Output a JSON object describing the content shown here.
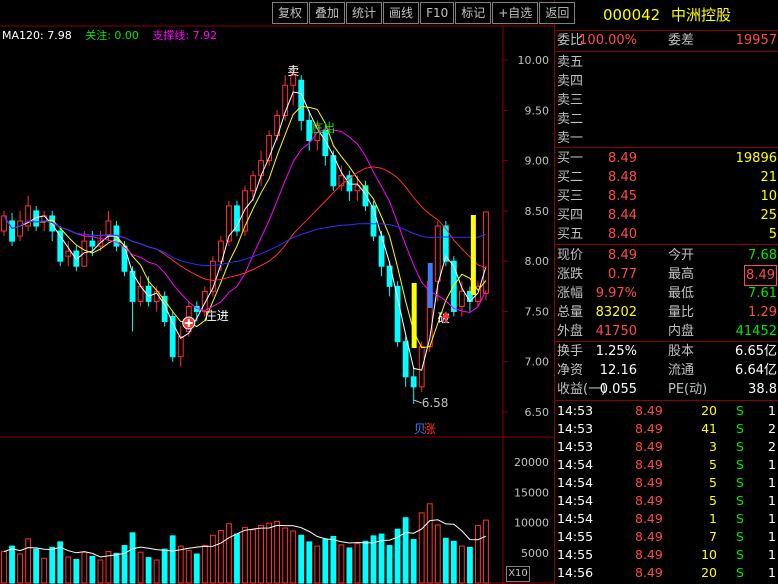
{
  "toolbar": {
    "buttons": [
      "复权",
      "叠加",
      "统计",
      "画线",
      "F10",
      "标记",
      "+自选",
      "返回"
    ]
  },
  "indicator_line": {
    "ma120": "MA120: 7.98",
    "focus": "关注: 0.00",
    "support": "支撑线: 7.92"
  },
  "annotations": {
    "sell": "卖",
    "zhuang_out": "庄出",
    "zhuang_in": "庄进",
    "break_down": "破",
    "low_price": "6.58",
    "limit_up": "涨",
    "limit_up_prefix": "贝"
  },
  "price_axis": [
    "10.00",
    "9.50",
    "9.00",
    "8.50",
    "8.00",
    "7.50",
    "7.00",
    "6.50"
  ],
  "volume_axis": [
    "20000",
    "15000",
    "10000",
    "5000"
  ],
  "volume_unit_button": "X10",
  "colors": {
    "up": "#ff3030",
    "down": "#00ffff",
    "ma_white": "#ffffff",
    "ma_yellow": "#ffff00",
    "ma_pink": "#ff00ff",
    "ma_red": "#ff3030",
    "ma_blue": "#3030ff"
  },
  "chart_data": {
    "type": "candlestick",
    "ylim": [
      6.5,
      10.2
    ],
    "candles": [
      [
        8.3,
        8.45,
        8.25,
        8.5
      ],
      [
        8.4,
        8.2,
        8.15,
        8.48
      ],
      [
        8.25,
        8.4,
        8.2,
        8.5
      ],
      [
        8.35,
        8.55,
        8.3,
        8.65
      ],
      [
        8.5,
        8.35,
        8.3,
        8.55
      ],
      [
        8.4,
        8.45,
        8.3,
        8.5
      ],
      [
        8.45,
        8.3,
        8.2,
        8.5
      ],
      [
        8.3,
        8.0,
        7.95,
        8.35
      ],
      [
        8.05,
        8.1,
        7.95,
        8.2
      ],
      [
        8.1,
        7.95,
        7.9,
        8.15
      ],
      [
        7.95,
        8.2,
        7.95,
        8.3
      ],
      [
        8.2,
        8.15,
        8.05,
        8.3
      ],
      [
        8.15,
        8.2,
        8.1,
        8.3
      ],
      [
        8.25,
        8.4,
        8.2,
        8.5
      ],
      [
        8.35,
        8.15,
        8.1,
        8.4
      ],
      [
        8.15,
        7.9,
        7.85,
        8.2
      ],
      [
        7.9,
        7.6,
        7.3,
        7.95
      ],
      [
        7.6,
        7.75,
        7.55,
        7.85
      ],
      [
        7.75,
        7.6,
        7.55,
        7.85
      ],
      [
        7.6,
        7.7,
        7.5,
        7.75
      ],
      [
        7.65,
        7.4,
        7.35,
        7.7
      ],
      [
        7.45,
        7.05,
        7.0,
        7.5
      ],
      [
        7.05,
        7.25,
        6.95,
        7.35
      ],
      [
        7.3,
        7.55,
        7.25,
        7.6
      ],
      [
        7.55,
        7.5,
        7.4,
        7.6
      ],
      [
        7.5,
        7.7,
        7.45,
        7.75
      ],
      [
        7.7,
        8.0,
        7.65,
        8.05
      ],
      [
        8.0,
        8.2,
        7.9,
        8.25
      ],
      [
        8.2,
        8.55,
        8.15,
        8.6
      ],
      [
        8.55,
        8.3,
        8.25,
        8.6
      ],
      [
        8.3,
        8.7,
        8.25,
        8.75
      ],
      [
        8.7,
        8.85,
        8.6,
        8.9
      ],
      [
        8.85,
        9.0,
        8.75,
        9.1
      ],
      [
        9.0,
        9.25,
        8.95,
        9.3
      ],
      [
        9.25,
        9.45,
        9.2,
        9.5
      ],
      [
        9.45,
        9.75,
        9.4,
        9.85
      ],
      [
        9.75,
        9.85,
        9.55,
        9.95
      ],
      [
        9.8,
        9.4,
        9.3,
        9.85
      ],
      [
        9.4,
        9.2,
        9.1,
        9.5
      ],
      [
        9.2,
        9.35,
        9.1,
        9.4
      ],
      [
        9.3,
        9.05,
        8.95,
        9.35
      ],
      [
        9.05,
        8.75,
        8.7,
        9.1
      ],
      [
        8.75,
        8.85,
        8.7,
        8.95
      ],
      [
        8.85,
        8.7,
        8.6,
        8.9
      ],
      [
        8.7,
        8.75,
        8.6,
        8.85
      ],
      [
        8.75,
        8.55,
        8.5,
        8.8
      ],
      [
        8.55,
        8.25,
        8.2,
        8.6
      ],
      [
        8.25,
        7.95,
        7.85,
        8.3
      ],
      [
        7.95,
        7.75,
        7.65,
        8.0
      ],
      [
        7.75,
        7.2,
        7.15,
        7.8
      ],
      [
        7.2,
        6.85,
        6.75,
        7.25
      ],
      [
        6.85,
        6.75,
        6.58,
        6.95
      ],
      [
        6.75,
        7.15,
        6.7,
        7.2
      ],
      [
        7.15,
        7.8,
        7.1,
        7.85
      ],
      [
        7.8,
        8.35,
        7.6,
        8.4
      ],
      [
        8.35,
        8.0,
        7.95,
        8.4
      ],
      [
        8.0,
        7.5,
        7.45,
        8.05
      ],
      [
        7.55,
        7.7,
        7.45,
        7.8
      ],
      [
        7.7,
        7.6,
        7.5,
        7.75
      ],
      [
        7.6,
        7.75,
        7.55,
        7.8
      ],
      [
        7.68,
        8.49,
        7.61,
        8.49
      ]
    ],
    "volumes": [
      5200,
      6100,
      4800,
      7300,
      5600,
      4100,
      5900,
      6800,
      4300,
      3900,
      5100,
      4400,
      3800,
      5200,
      4900,
      6200,
      8300,
      5100,
      4200,
      3800,
      5600,
      7800,
      6100,
      5400,
      4800,
      6200,
      7900,
      8700,
      9800,
      8100,
      9200,
      8800,
      9500,
      9900,
      10200,
      9100,
      8600,
      7900,
      6800,
      6100,
      7200,
      7700,
      6300,
      5800,
      6500,
      6900,
      7800,
      8100,
      6200,
      8900,
      10800,
      7200,
      11600,
      13100,
      9600,
      7400,
      6900,
      6100,
      5900,
      9500,
      10400
    ],
    "title": "000042 中洲控股"
  },
  "panel": {
    "code": "000042",
    "name": "中洲控股",
    "weibi_label": "委比",
    "weibi_value": "100.00%",
    "weicha_label": "委差",
    "weicha_value": "19957",
    "sell_levels": [
      {
        "label": "卖五",
        "price": "",
        "vol": ""
      },
      {
        "label": "卖四",
        "price": "",
        "vol": ""
      },
      {
        "label": "卖三",
        "price": "",
        "vol": ""
      },
      {
        "label": "卖二",
        "price": "",
        "vol": ""
      },
      {
        "label": "卖一",
        "price": "",
        "vol": ""
      }
    ],
    "buy_levels": [
      {
        "label": "买一",
        "price": "8.49",
        "vol": "19896"
      },
      {
        "label": "买二",
        "price": "8.48",
        "vol": "21"
      },
      {
        "label": "买三",
        "price": "8.45",
        "vol": "10"
      },
      {
        "label": "买四",
        "price": "8.44",
        "vol": "25"
      },
      {
        "label": "买五",
        "price": "8.40",
        "vol": "5"
      }
    ],
    "quote": [
      {
        "l1": "现价",
        "v1": "8.49",
        "c1": "red",
        "l2": "今开",
        "v2": "7.68",
        "c2": "green"
      },
      {
        "l1": "涨跌",
        "v1": "0.77",
        "c1": "red",
        "l2": "最高",
        "v2": "8.49",
        "c2": "red",
        "box2": true
      },
      {
        "l1": "涨幅",
        "v1": "9.97%",
        "c1": "red",
        "l2": "最低",
        "v2": "7.61",
        "c2": "green"
      },
      {
        "l1": "总量",
        "v1": "83202",
        "c1": "yellow",
        "l2": "量比",
        "v2": "1.29",
        "c2": "red"
      },
      {
        "l1": "外盘",
        "v1": "41750",
        "c1": "red",
        "l2": "内盘",
        "v2": "41452",
        "c2": "green"
      }
    ],
    "fundamentals": [
      {
        "l1": "换手",
        "v1": "1.25%",
        "l2": "股本",
        "v2": "6.65亿"
      },
      {
        "l1": "净资",
        "v1": "12.16",
        "l2": "流通",
        "v2": "6.64亿"
      },
      {
        "l1": "收益(一)",
        "v1": "0.055",
        "l2": "PE(动)",
        "v2": "38.8"
      }
    ],
    "ticks": [
      {
        "time": "14:53",
        "price": "8.49",
        "vol": "20",
        "side": "S",
        "n": "1"
      },
      {
        "time": "14:53",
        "price": "8.49",
        "vol": "41",
        "side": "S",
        "n": "2"
      },
      {
        "time": "14:53",
        "price": "8.49",
        "vol": "3",
        "side": "S",
        "n": "2"
      },
      {
        "time": "14:54",
        "price": "8.49",
        "vol": "5",
        "side": "S",
        "n": "1"
      },
      {
        "time": "14:54",
        "price": "8.49",
        "vol": "5",
        "side": "S",
        "n": "1"
      },
      {
        "time": "14:54",
        "price": "8.49",
        "vol": "5",
        "side": "S",
        "n": "1"
      },
      {
        "time": "14:54",
        "price": "8.49",
        "vol": "1",
        "side": "S",
        "n": "1"
      },
      {
        "time": "14:55",
        "price": "8.49",
        "vol": "7",
        "side": "S",
        "n": "1"
      },
      {
        "time": "14:55",
        "price": "8.49",
        "vol": "10",
        "side": "S",
        "n": "1"
      },
      {
        "time": "14:56",
        "price": "8.49",
        "vol": "20",
        "side": "S",
        "n": "1"
      }
    ]
  }
}
